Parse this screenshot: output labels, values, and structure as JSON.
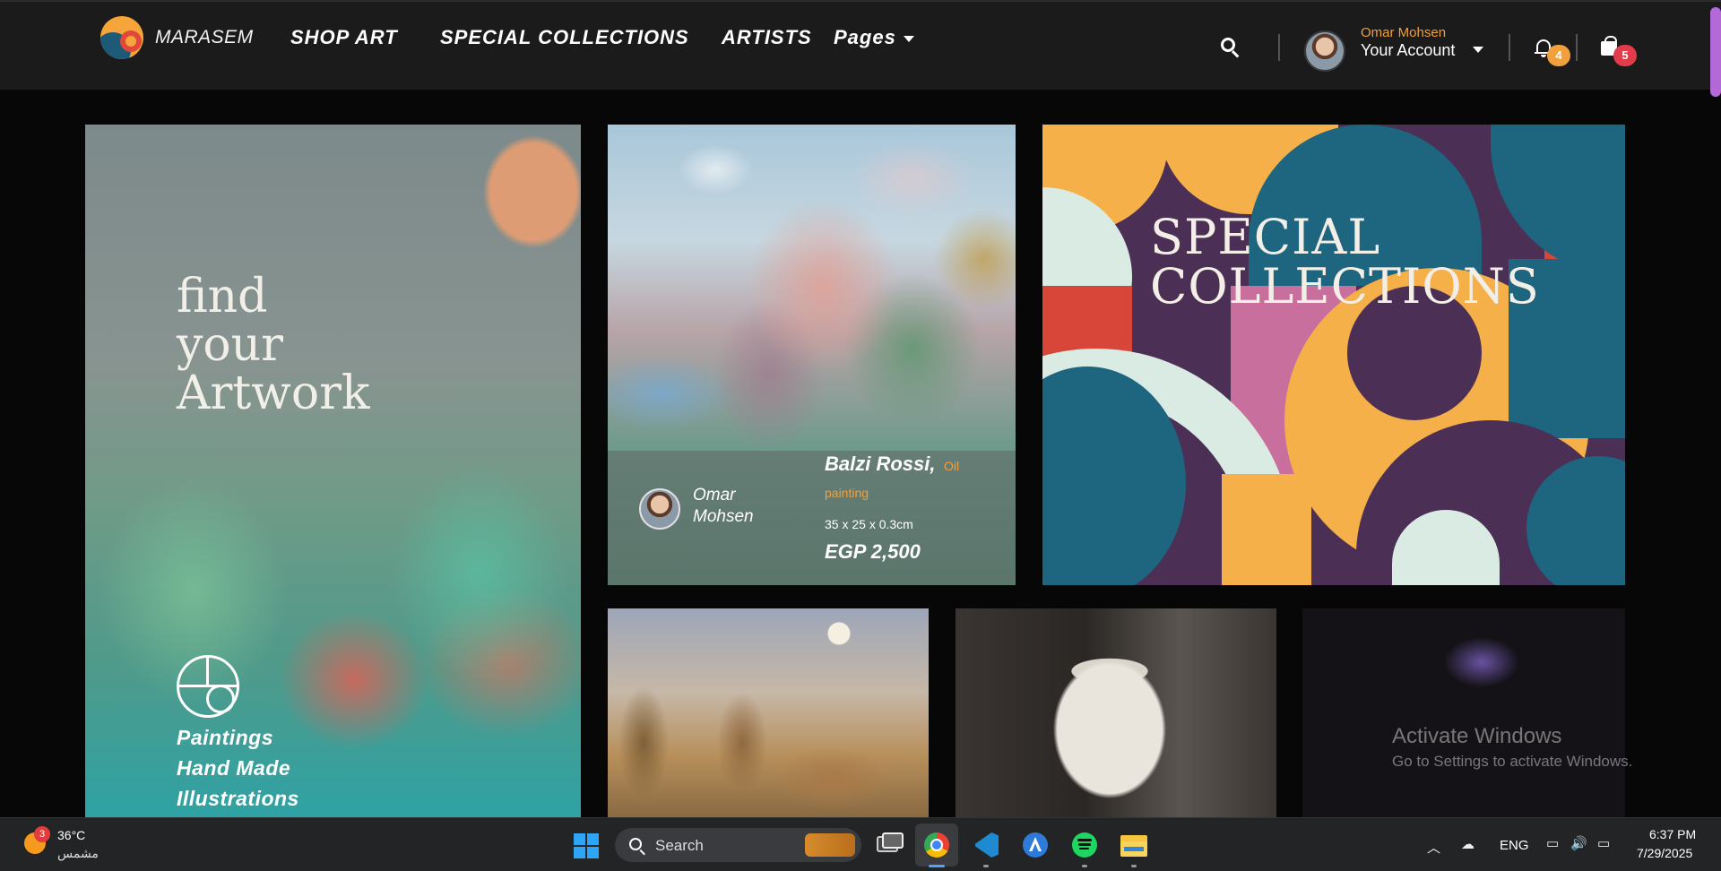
{
  "navbar": {
    "brand": "MARASEM",
    "links": [
      "SHOP ART",
      "SPECIAL COLLECTIONS",
      "ARTISTS"
    ],
    "pages_label": "Pages",
    "account": {
      "name": "Omar Mohsen",
      "label": "Your Account"
    },
    "notifications_count": "4",
    "cart_count": "5",
    "colors": {
      "accent": "#f0a03c",
      "notif_badge": "#f0a03c",
      "cart_badge": "#e23c4a"
    }
  },
  "hero": {
    "title_lines": [
      "find",
      "your",
      "Artwork"
    ],
    "categories": [
      "Paintings",
      "Hand Made",
      "Illustrations"
    ]
  },
  "featured": {
    "artist": "Omar Mohsen",
    "title": "Balzi Rossi,",
    "medium_a": "Oil",
    "medium_b": "painting",
    "size": "35 x 25 x 0.3cm",
    "price": "EGP 2,500"
  },
  "special": {
    "title_lines": [
      "SPECIAL",
      "COLLECTIONS"
    ]
  },
  "watermark": {
    "line1": "Activate Windows",
    "line2": "Go to Settings to activate Windows."
  },
  "taskbar": {
    "weather_badge": "3",
    "weather_temp": "36°C",
    "weather_desc": "مشمس",
    "search_placeholder": "Search",
    "lang": "ENG",
    "time": "6:37 PM",
    "date": "7/29/2025",
    "icons": [
      "weather-sun-icon",
      "windows-start-icon",
      "search-icon",
      "task-view-icon",
      "chrome-icon",
      "vscode-icon",
      "android-studio-icon",
      "spotify-icon",
      "file-explorer-icon",
      "chevron-up-icon",
      "cloud-off-icon",
      "network-icon",
      "volume-icon",
      "battery-icon"
    ]
  }
}
